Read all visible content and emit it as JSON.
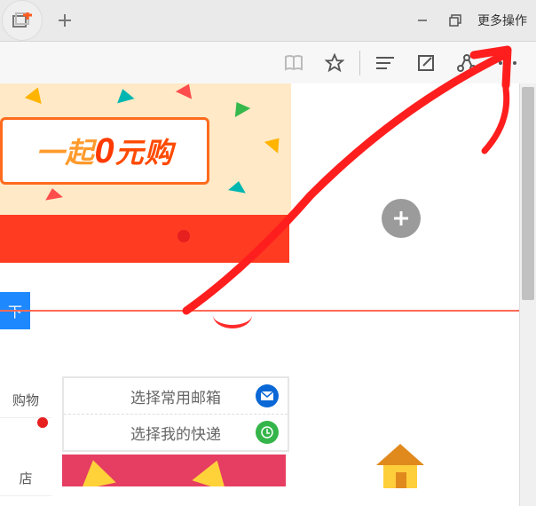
{
  "titlebar": {
    "more_actions_label": "更多操作"
  },
  "ad": {
    "lead_text": "一起",
    "zero_text": "0",
    "trail_text": "元购"
  },
  "blue_button_label": "下",
  "sidebar": {
    "item_shopping": "购物",
    "item_store": "店"
  },
  "panel": {
    "row_mail": "选择常用邮箱",
    "row_express": "选择我的快递"
  }
}
